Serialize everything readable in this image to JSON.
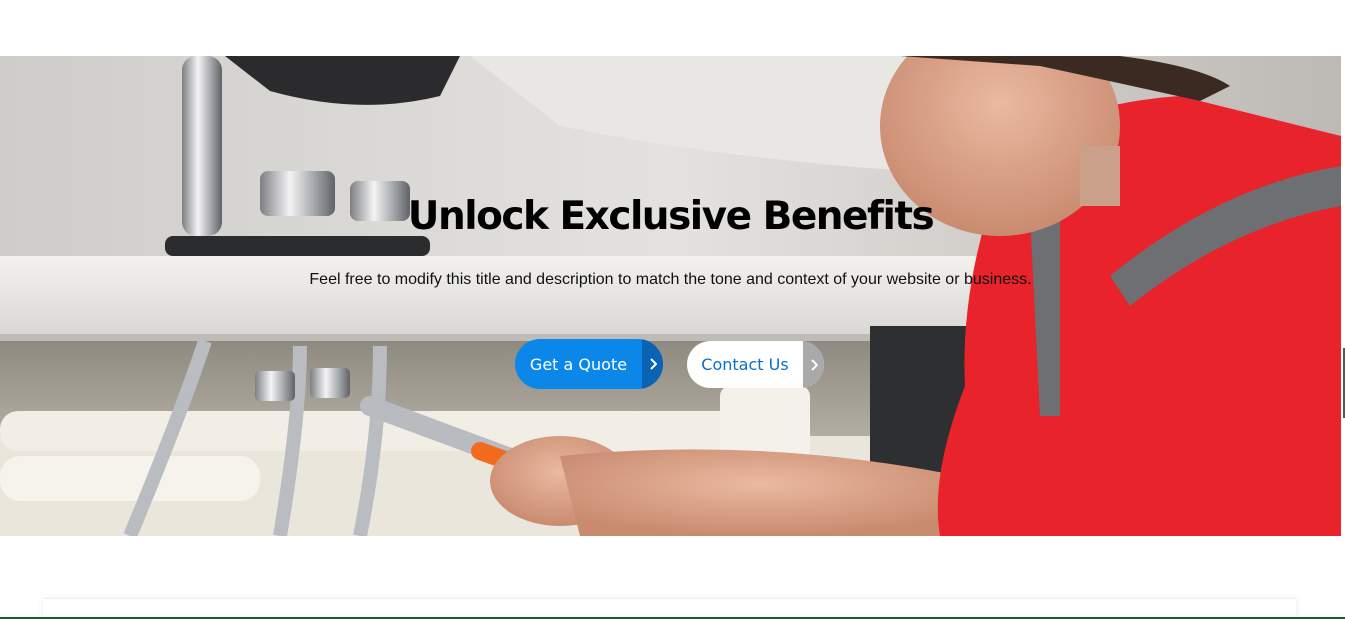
{
  "hero": {
    "title": "Unlock Exclusive Benefits",
    "description": "Feel free to modify this title and description to match the tone and context of your website or business.",
    "primary_button_label": "Get a Quote",
    "secondary_button_label": "Contact Us",
    "primary_button_icon": "chevron-right-icon",
    "secondary_button_icon": "chevron-right-icon"
  },
  "colors": {
    "primary_button": "#0b87ea",
    "primary_button_arrow": "#0a63b5",
    "secondary_button_text": "#0b6fc9",
    "shirt_red": "#e8232c"
  }
}
